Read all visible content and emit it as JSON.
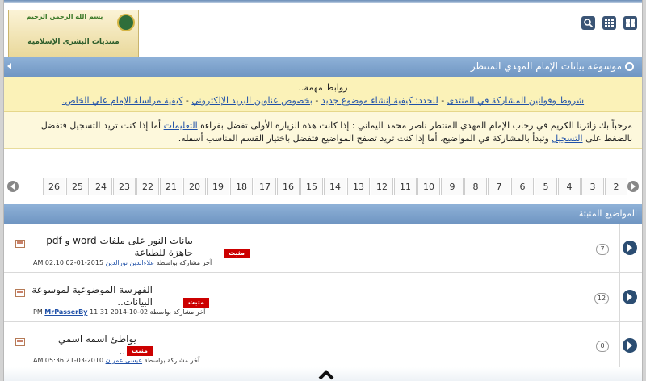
{
  "header": {
    "logo": {
      "line1": "بسم الله الرحمن الرحيم",
      "line2": "",
      "line3": "منتديات البشرى الإسلامية"
    },
    "icons": [
      "grid-icon",
      "apps-icon",
      "search-icon"
    ]
  },
  "titlebar": {
    "title": "موسوعة بيانات الإمام المهدي المنتظر"
  },
  "notice": {
    "title": "روابط مهمة..",
    "links": [
      "شروط وقوانين المشاركة في المنتدى",
      "للحدد: كيفية إنشاء موضوع جديد",
      "بخصوص عناوين البريد الإلكتروني",
      "كيفية مراسلة الإمام علي الخاص."
    ],
    "sep": "-"
  },
  "welcome": {
    "part1": "مرحباً بك زائرنا الكريم في رحاب الإمام المهدي المنتظر ناصر محمد اليماني : إذا كانت هذه الزيارة الأولى تفضل بقراءة",
    "link1": "التعليمات",
    "part2": "أما إذا كنت تريد التسجيل فتفضل بالضغط على",
    "link2": "التسجيل",
    "part3": "وتبدأ بالمشاركة في المواضيع، أما إذا كنت تريد تصفح المواضيع فتفضل باختيار القسم المناسب أسفله."
  },
  "pagination": {
    "pages": [
      "26",
      "25",
      "24",
      "23",
      "22",
      "21",
      "20",
      "19",
      "18",
      "17",
      "16",
      "15",
      "14",
      "13",
      "12",
      "11",
      "10",
      "9",
      "8",
      "7",
      "6",
      "5",
      "4",
      "3",
      "2"
    ]
  },
  "sticky": {
    "header": "المواضيع المثبتة"
  },
  "threads": [
    {
      "title": "بيانات النور على ملفات word و pdf جاهزة للطباعة",
      "badge": "مثبت",
      "meta_prefix": "آخر مشاركة بواسطة",
      "author": "علاءالدين نورالدين",
      "date": "2015-01-02 02:10 AM",
      "count": "7"
    },
    {
      "title": "الفهرسة الموضوعية لموسوعة البيانات..",
      "badge": "مثبت",
      "meta_prefix": "آخر مشاركة بواسطة",
      "author": "MrPasserBy",
      "date": "02-10-2014 11:31 PM",
      "count": "12"
    },
    {
      "title": "يواطئ اسمه اسمي",
      "suffix": "..",
      "badge": "مثبت",
      "meta_prefix": "آخر مشاركة بواسطة",
      "author": "عيسى عمران",
      "date": "2010-03-21 05:36 AM",
      "count": "0"
    }
  ]
}
